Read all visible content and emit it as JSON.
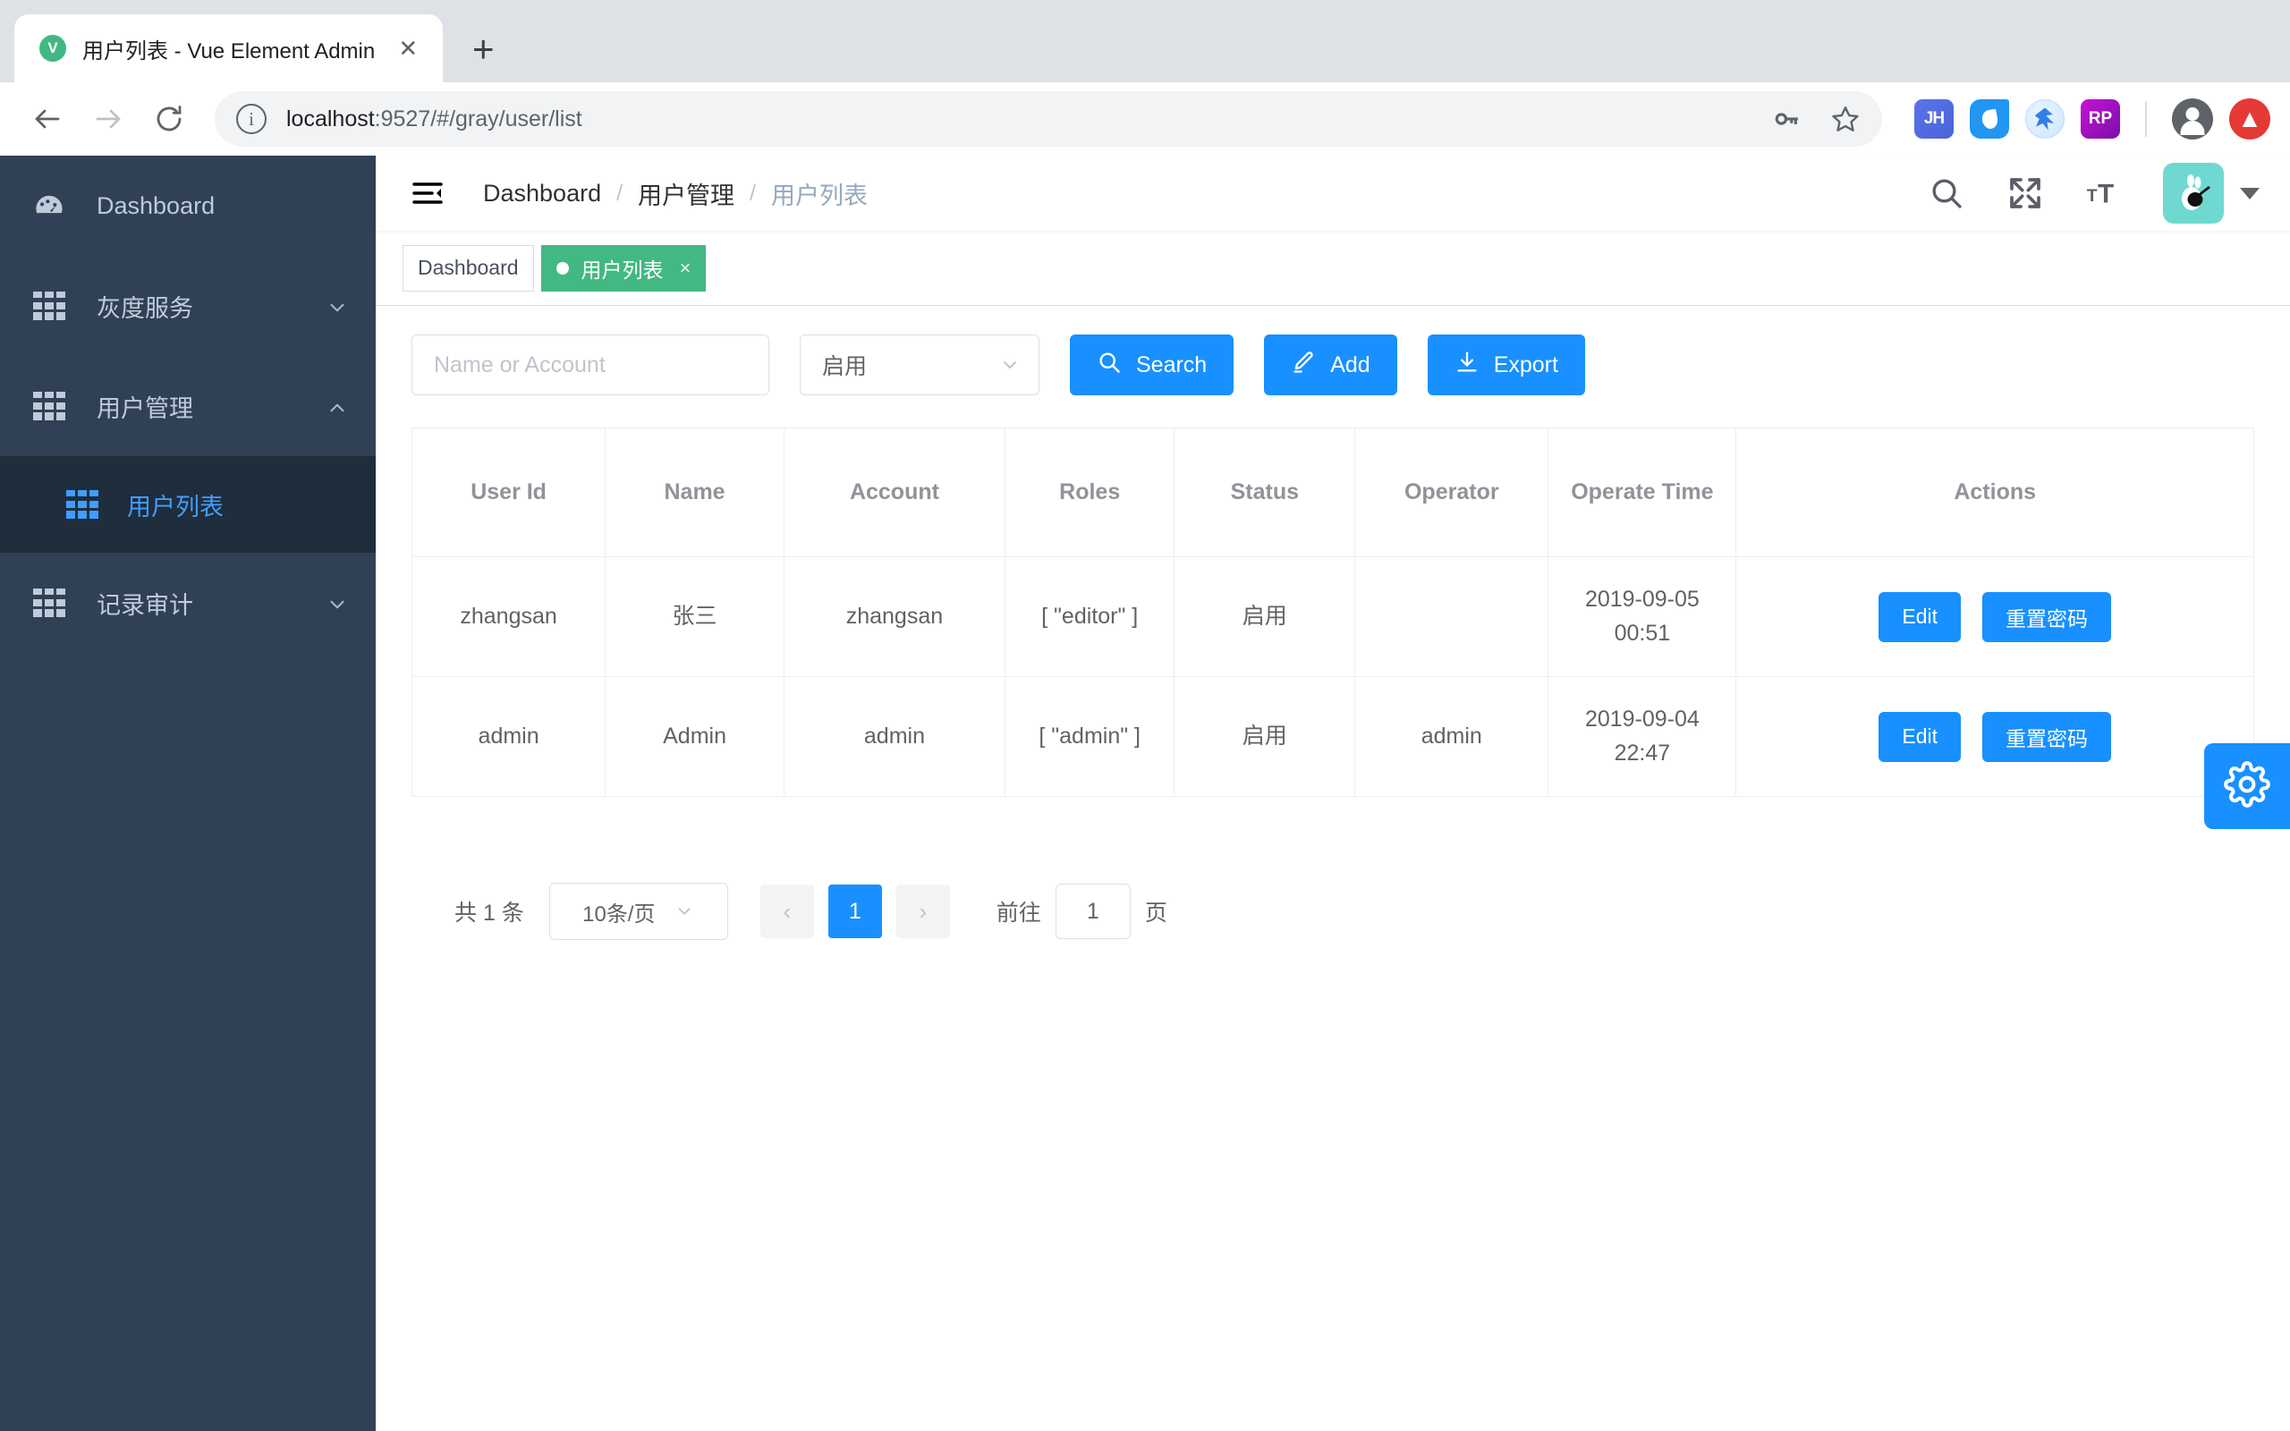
{
  "browser": {
    "tab": {
      "title": "用户列表 - Vue Element Admin",
      "favicon_letter": "V",
      "close_label": "✕"
    },
    "new_tab_label": "+",
    "url_bold": "localhost",
    "url_rest": ":9527/#/gray/user/list",
    "info_icon_label": "i",
    "extensions": [
      {
        "name": "jh-extension-icon",
        "label": "JH"
      },
      {
        "name": "water-drop-extension-icon",
        "label": ""
      },
      {
        "name": "blue-bird-extension-icon",
        "label": ""
      },
      {
        "name": "rp-extension-icon",
        "label": "RP"
      }
    ]
  },
  "sidebar": {
    "items": [
      {
        "label": "Dashboard",
        "icon": "dashboard-icon",
        "arrow": "",
        "active": false
      },
      {
        "label": "灰度服务",
        "icon": "grid-icon",
        "arrow": "down",
        "active": false
      },
      {
        "label": "用户管理",
        "icon": "grid-icon",
        "arrow": "up",
        "active": false
      }
    ],
    "submenu": {
      "label": "用户列表",
      "icon": "grid-icon",
      "active": true
    },
    "items_after": [
      {
        "label": "记录审计",
        "icon": "grid-icon",
        "arrow": "down",
        "active": false
      }
    ]
  },
  "navbar": {
    "hamburger": "hamburger-icon",
    "breadcrumb": [
      {
        "label": "Dashboard",
        "current": false
      },
      {
        "label": "用户管理",
        "current": false
      },
      {
        "label": "用户列表",
        "current": true
      }
    ],
    "separator": "/",
    "icons": [
      "search-icon",
      "fullscreen-icon",
      "font-size-icon"
    ]
  },
  "tagsview": {
    "tags": [
      {
        "label": "Dashboard",
        "active": false,
        "closable": false
      },
      {
        "label": "用户列表",
        "active": true,
        "closable": true,
        "close": "×"
      }
    ]
  },
  "filterbar": {
    "search_placeholder": "Name or Account",
    "search_value": "",
    "status_value": "启用",
    "buttons": [
      {
        "label": "Search",
        "icon": "search-icon"
      },
      {
        "label": "Add",
        "icon": "edit-icon"
      },
      {
        "label": "Export",
        "icon": "download-icon"
      }
    ]
  },
  "table": {
    "columns": [
      "User Id",
      "Name",
      "Account",
      "Roles",
      "Status",
      "Operator",
      "Operate Time",
      "Actions"
    ],
    "rows": [
      {
        "user_id": "zhangsan",
        "name": "张三",
        "account": "zhangsan",
        "roles": "[ \"editor\" ]",
        "status": "启用",
        "operator": "",
        "operate_time": "2019-09-05 00:51",
        "actions": [
          "Edit",
          "重置密码"
        ]
      },
      {
        "user_id": "admin",
        "name": "Admin",
        "account": "admin",
        "roles": "[ \"admin\" ]",
        "status": "启用",
        "operator": "admin",
        "operate_time": "2019-09-04 22:47",
        "actions": [
          "Edit",
          "重置密码"
        ]
      }
    ]
  },
  "pagination": {
    "total_label": "共 1 条",
    "page_size": "10条/页",
    "prev": "‹",
    "next": "›",
    "current_page": "1",
    "jump_prefix": "前往",
    "jump_value": "1",
    "jump_suffix": "页"
  },
  "settings_fab": {
    "icon": "gear-icon"
  },
  "colors": {
    "primary": "#1890ff",
    "sidebar_bg": "#304156",
    "sidebar_active_bg": "#1f2d3d",
    "sidebar_active_text": "#409eff",
    "tag_active": "#42b983",
    "avatar_bg": "#6fd8d1"
  }
}
